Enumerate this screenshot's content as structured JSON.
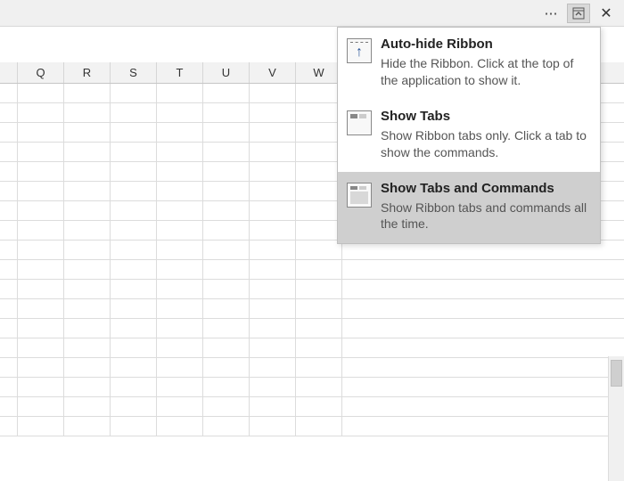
{
  "titlebar": {
    "more_label": "⋯"
  },
  "columns": [
    "Q",
    "R",
    "S",
    "T",
    "U",
    "V",
    "W"
  ],
  "menu": {
    "items": [
      {
        "icon": "auto-hide-ribbon-icon",
        "title": "Auto-hide Ribbon",
        "desc": "Hide the Ribbon. Click at the top of the application to show it.",
        "selected": false
      },
      {
        "icon": "show-tabs-icon",
        "title": "Show Tabs",
        "desc": "Show Ribbon tabs only. Click a tab to show the commands.",
        "selected": false
      },
      {
        "icon": "show-tabs-commands-icon",
        "title": "Show Tabs and Commands",
        "desc": "Show Ribbon tabs and commands all the time.",
        "selected": true
      }
    ]
  }
}
